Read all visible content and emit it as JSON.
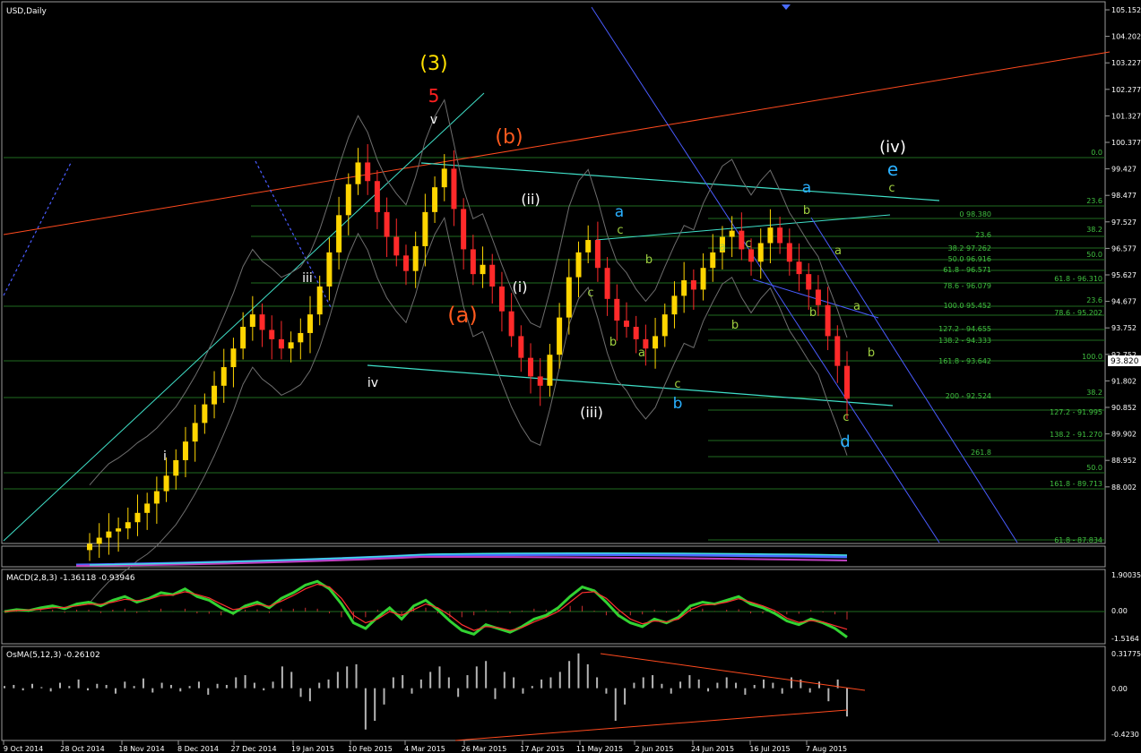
{
  "symbol_label": "USD,Daily",
  "macd_label": "MACD(2,8,3) -1.36118 -0.93946",
  "osma_label": "OsMA(5,12,3) -0.26102",
  "colors": {
    "background": "#000000",
    "grid": "#1f6b1f",
    "bull_candle": "#ffd500",
    "bear_candle": "#ff2a2a",
    "envelope": "#6e6e6e",
    "blue_channel": "#4a5cff",
    "red_trend": "#ff4a1e",
    "cyan_trend": "#3fe0c8",
    "macd_main": "#32d232",
    "macd_signal": "#ff3030",
    "osma_bar": "#b4b4b4",
    "fib_text": "#40c040"
  },
  "chart_data": [
    {
      "type": "candlestick",
      "title": "USD,Daily",
      "x_labels": [
        "9 Oct 2014",
        "28 Oct 2014",
        "18 Nov 2014",
        "8 Dec 2014",
        "27 Dec 2014",
        "19 Jan 2015",
        "10 Feb 2015",
        "4 Mar 2015",
        "26 Mar 2015",
        "17 Apr 2015",
        "11 May 2015",
        "2 Jun 2015",
        "24 Jun 2015",
        "16 Jul 2015",
        "7 Aug 2015"
      ],
      "y_ticks": [
        "105.152",
        "104.202",
        "103.227",
        "102.277",
        "101.327",
        "100.377",
        "99.427",
        "98.477",
        "97.527",
        "96.577",
        "95.627",
        "94.677",
        "93.752",
        "92.752",
        "91.802",
        "90.852",
        "89.902",
        "88.952",
        "88.002"
      ],
      "ylim": [
        88.0,
        105.15
      ],
      "current_price": "93.820",
      "close_series": [
        87.9,
        88.1,
        88.3,
        88.4,
        88.6,
        88.9,
        89.2,
        89.6,
        90.1,
        90.6,
        91.2,
        91.8,
        92.4,
        93.0,
        93.6,
        94.2,
        94.9,
        95.3,
        94.8,
        94.5,
        94.2,
        94.4,
        94.7,
        95.3,
        96.2,
        97.3,
        98.5,
        99.5,
        100.2,
        99.6,
        98.6,
        97.8,
        97.2,
        96.7,
        97.5,
        98.6,
        99.4,
        100.0,
        98.7,
        97.4,
        96.6,
        96.9,
        96.2,
        95.4,
        94.6,
        93.9,
        93.3,
        93.0,
        94.0,
        95.2,
        96.5,
        97.3,
        97.7,
        96.8,
        95.8,
        95.1,
        94.9,
        94.5,
        94.2,
        94.6,
        95.3,
        95.9,
        96.4,
        96.1,
        96.8,
        97.3,
        97.8,
        98.0,
        97.4,
        97.0,
        97.6,
        98.1,
        97.6,
        97.0,
        96.6,
        96.1,
        95.6,
        94.6,
        93.64,
        92.58
      ],
      "wave_labels": [
        "(3)",
        "5",
        "v",
        "(b)",
        "(iv)",
        "e",
        "c",
        "iii",
        "(a)",
        "(ii)",
        "(i)",
        "a",
        "c",
        "b",
        "c",
        "a",
        "a",
        "c",
        "b",
        "a",
        "b",
        "a",
        "b",
        "b",
        "a",
        "b",
        "(iii)",
        "c",
        "b",
        "iv",
        "i",
        "c",
        "d"
      ],
      "fib_levels": [
        "0.0",
        "23.6",
        "0 98.380",
        "38.2",
        "23.6",
        "38.2 97.262",
        "50.0",
        "50.0 96.916",
        "61.8 - 96.571",
        "61.8 - 96.310",
        "78.6 - 96.079",
        "23.6",
        "100.0 95.452",
        "78.6 - 95.202",
        "127.2 - 94.655",
        "138.2 - 94.333",
        "100.0",
        "161.8 - 93.642",
        "38.2",
        "200 - 92.524",
        "127.2 - 91.995",
        "138.2 - 91.270",
        "261.8",
        "50.0",
        "161.8 - 89.713",
        "61.8 - 87.834"
      ]
    },
    {
      "type": "line",
      "title": "MACD(2,8,3) -1.36118 -0.93946",
      "y_ticks": [
        "1.90035",
        "0.00",
        "-1.5164"
      ],
      "ylim": [
        -1.52,
        1.9
      ],
      "series": [
        {
          "name": "",
          "values": [
            0,
            0.1,
            0.05,
            0.2,
            0.3,
            0.15,
            0.4,
            0.5,
            0.3,
            0.6,
            0.8,
            0.5,
            0.7,
            1.0,
            0.9,
            1.2,
            0.8,
            0.6,
            0.2,
            -0.1,
            0.3,
            0.5,
            0.2,
            0.7,
            1.0,
            1.4,
            1.6,
            1.2,
            0.4,
            -0.6,
            -0.9,
            -0.3,
            0.2,
            -0.4,
            0.3,
            0.6,
            0.1,
            -0.5,
            -1.0,
            -1.2,
            -0.7,
            -0.9,
            -1.1,
            -0.8,
            -0.4,
            -0.2,
            0.2,
            0.8,
            1.3,
            1.1,
            0.5,
            -0.2,
            -0.6,
            -0.8,
            -0.4,
            -0.6,
            -0.3,
            0.3,
            0.5,
            0.4,
            0.6,
            0.8,
            0.4,
            0.2,
            -0.1,
            -0.5,
            -0.7,
            -0.4,
            -0.6,
            -0.9,
            -1.36
          ]
        },
        {
          "name": "",
          "values": [
            0,
            0.05,
            0.08,
            0.12,
            0.2,
            0.22,
            0.3,
            0.4,
            0.38,
            0.5,
            0.65,
            0.58,
            0.65,
            0.85,
            0.88,
            1.05,
            0.9,
            0.72,
            0.4,
            0.1,
            0.2,
            0.38,
            0.28,
            0.55,
            0.85,
            1.2,
            1.45,
            1.3,
            0.7,
            -0.2,
            -0.6,
            -0.4,
            0.0,
            -0.2,
            0.1,
            0.4,
            0.2,
            -0.2,
            -0.7,
            -1.0,
            -0.8,
            -0.85,
            -1.0,
            -0.85,
            -0.55,
            -0.3,
            0.0,
            0.5,
            1.0,
            1.05,
            0.7,
            0.1,
            -0.4,
            -0.65,
            -0.5,
            -0.55,
            -0.4,
            0.1,
            0.35,
            0.38,
            0.5,
            0.68,
            0.5,
            0.3,
            0.05,
            -0.35,
            -0.58,
            -0.48,
            -0.55,
            -0.75,
            -0.94
          ]
        }
      ]
    },
    {
      "type": "bar",
      "title": "OsMA(5,12,3) -0.26102",
      "y_ticks": [
        "0.31775",
        "0.00",
        "-0.4230"
      ],
      "ylim": [
        -0.423,
        0.318
      ],
      "values": [
        0.02,
        0.03,
        -0.02,
        0.04,
        0.01,
        -0.03,
        0.05,
        0.02,
        0.08,
        -0.02,
        0.04,
        0.03,
        -0.05,
        0.06,
        0.02,
        0.09,
        -0.04,
        0.05,
        0.03,
        -0.03,
        0.02,
        0.06,
        -0.06,
        0.04,
        0.03,
        0.1,
        0.12,
        0.05,
        -0.02,
        0.06,
        0.2,
        0.15,
        -0.08,
        -0.12,
        0.05,
        0.08,
        0.15,
        0.2,
        0.22,
        -0.38,
        -0.3,
        -0.15,
        0.1,
        0.12,
        -0.05,
        0.08,
        0.15,
        0.2,
        0.1,
        -0.08,
        0.12,
        0.2,
        0.25,
        -0.1,
        0.15,
        0.1,
        -0.05,
        0.02,
        0.08,
        0.1,
        0.15,
        0.25,
        0.32,
        0.22,
        0.1,
        -0.05,
        -0.3,
        -0.15,
        0.05,
        0.1,
        0.12,
        0.04,
        -0.05,
        0.06,
        0.12,
        0.08,
        -0.03,
        0.05,
        0.1,
        0.05,
        -0.06,
        0.03,
        0.08,
        0.05,
        -0.05,
        0.1,
        0.08,
        -0.04,
        0.06,
        -0.12,
        0.08,
        -0.26
      ]
    }
  ]
}
